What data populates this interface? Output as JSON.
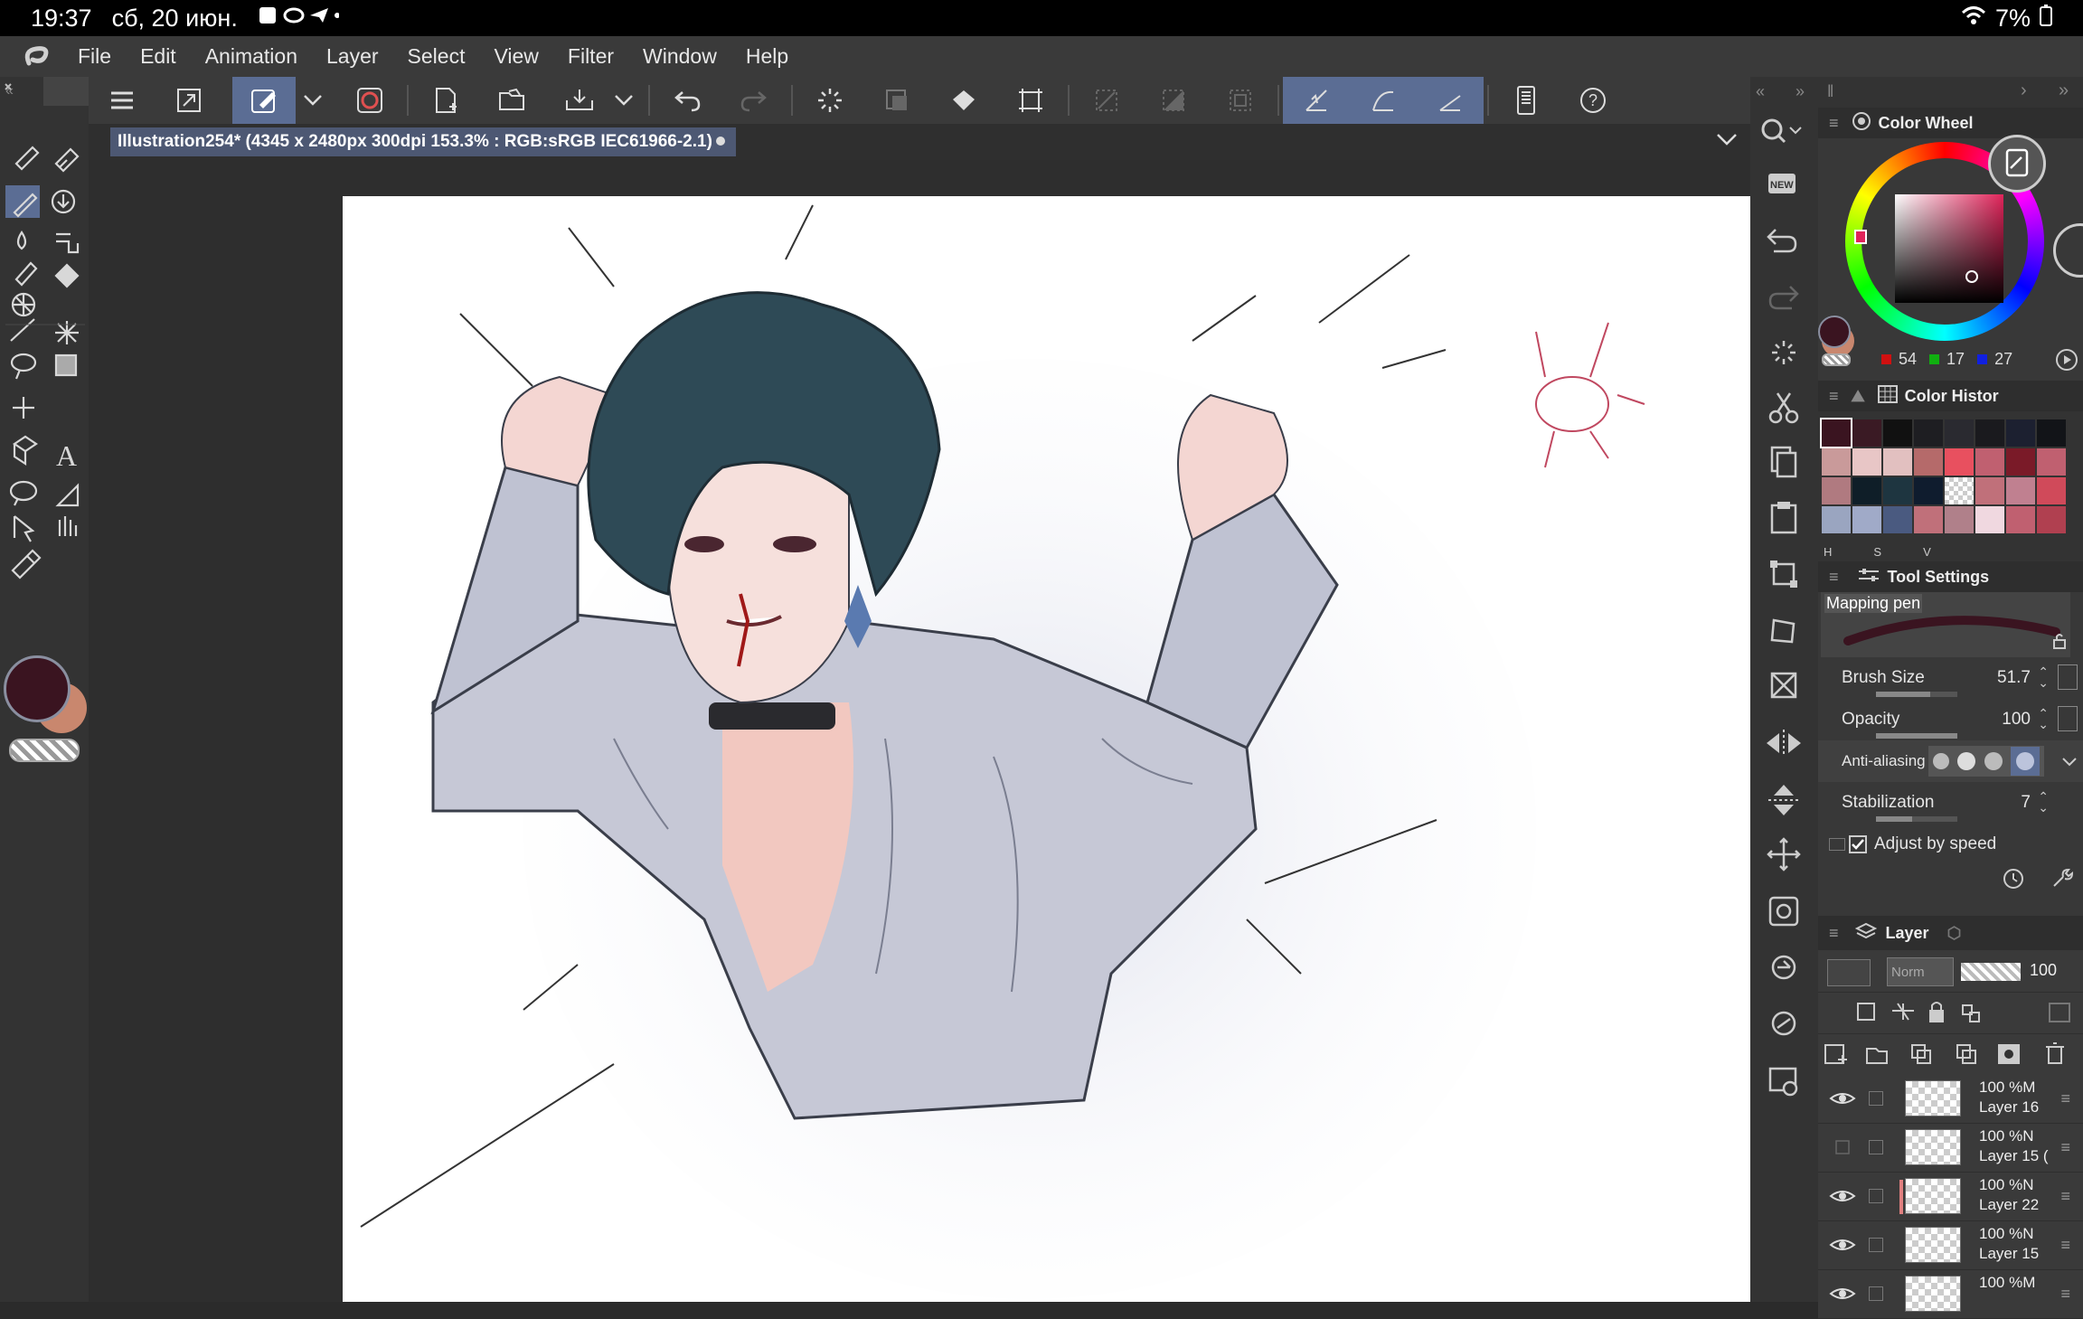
{
  "statusbar": {
    "time": "19:37",
    "date": "сб, 20 июн.",
    "battery": "7%"
  },
  "menu": [
    "File",
    "Edit",
    "Animation",
    "Layer",
    "Select",
    "View",
    "Filter",
    "Window",
    "Help"
  ],
  "tab": {
    "title": "Illustration254* (4345 x 2480px 300dpi 153.3% : RGB:sRGB IEC61966-2.1)"
  },
  "colorwheel": {
    "title": "Color Wheel",
    "r": "54",
    "g": "17",
    "b": "27",
    "main_color": "#3a1420",
    "sub_color": "#c9876e"
  },
  "colorhistory": {
    "title": "Color Histor",
    "hsv": [
      "H",
      "S",
      "V"
    ],
    "swatches": [
      "#3a1420",
      "#3a1a24",
      "#111111",
      "#1e1e22",
      "#2a2a30",
      "#1a1a1e",
      "#1c2030",
      "#121418",
      "#c99a9a",
      "#e8c6c6",
      "#e2c0c0",
      "#b56a6a",
      "#e8505f",
      "#c06070",
      "#7a1a28",
      "#c06070",
      "#b07a80",
      "#0f1e28",
      "#1e3540",
      "#0f1c2e",
      "#checker",
      "#c0707a",
      "#c08090",
      "#d04a5a",
      "#9aa5c0",
      "#a0aac8",
      "#4a5a80",
      "#c0707a",
      "#b0808a",
      "#f0d8e0",
      "#c06070",
      "#b04050"
    ]
  },
  "toolsettings": {
    "title": "Tool Settings",
    "brush_name": "Mapping pen",
    "brush_size_label": "Brush Size",
    "brush_size": "51.7",
    "opacity_label": "Opacity",
    "opacity": "100",
    "antialias_label": "Anti-aliasing",
    "stabilization_label": "Stabilization",
    "stabilization": "7",
    "adjust_label": "Adjust by speed"
  },
  "layer": {
    "title": "Layer",
    "blend": "Norm",
    "opacity": "100",
    "rows": [
      {
        "pct": "100 %M",
        "name": "Layer 16",
        "visible": true
      },
      {
        "pct": "100 %N",
        "name": "Layer 15 (",
        "visible": false
      },
      {
        "pct": "100 %N",
        "name": "Layer 22",
        "visible": true
      },
      {
        "pct": "100 %N",
        "name": "Layer 15",
        "visible": true
      },
      {
        "pct": "100 %M",
        "name": "",
        "visible": true
      }
    ]
  }
}
